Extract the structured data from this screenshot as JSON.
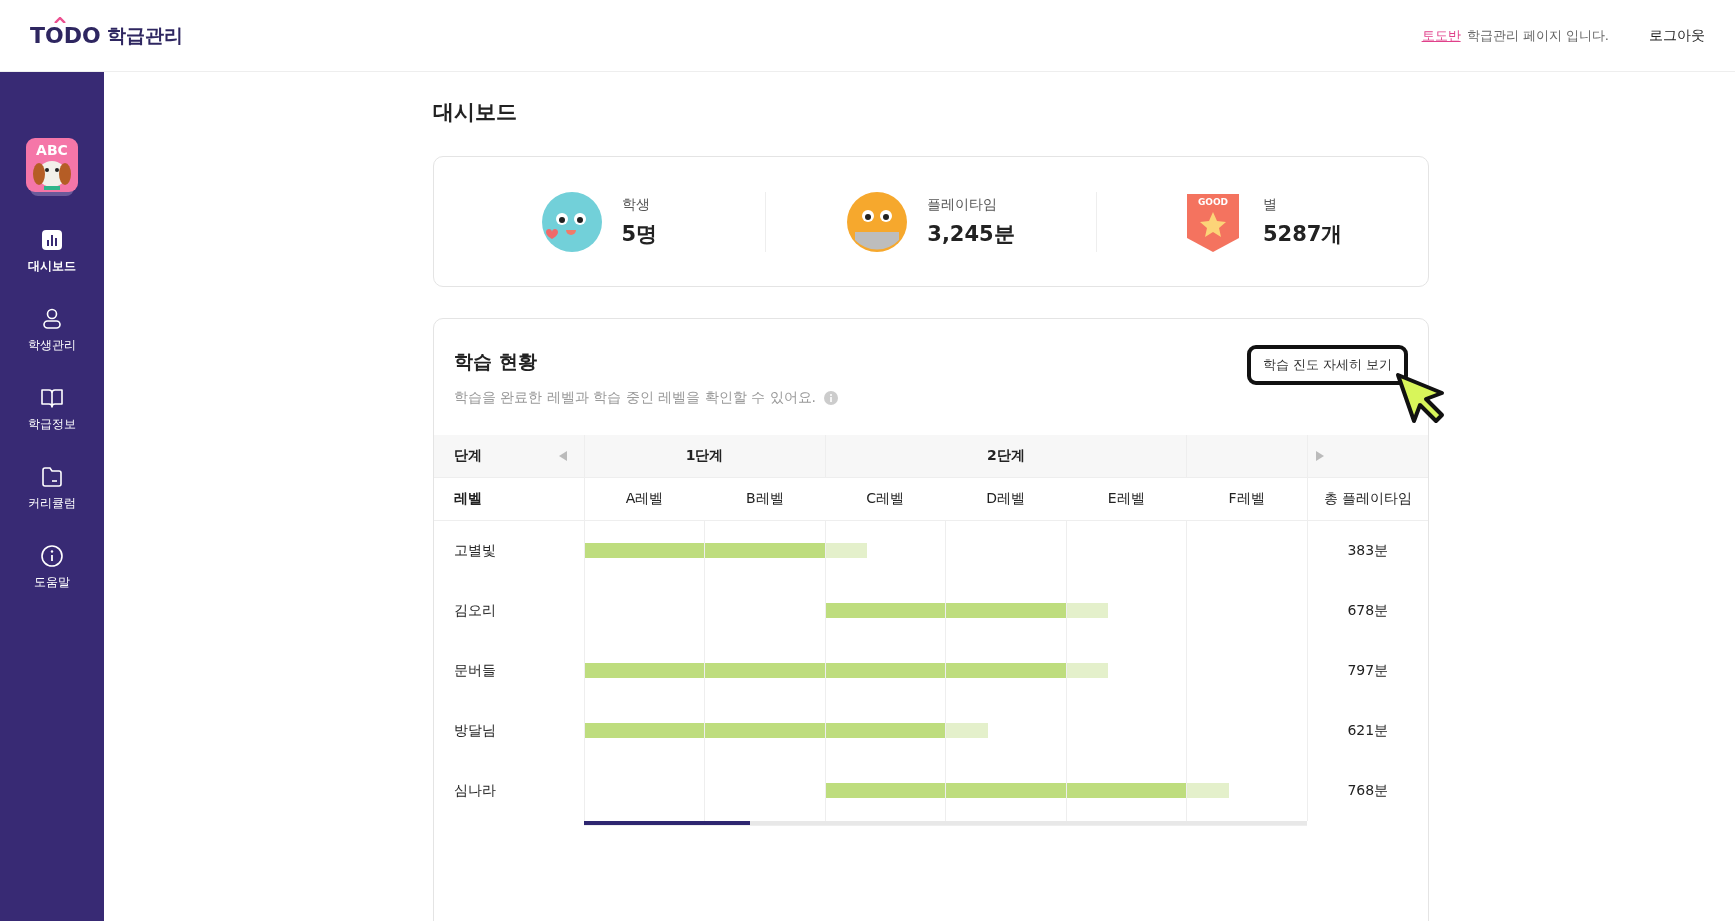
{
  "header": {
    "logo_text": "TODO",
    "logo_subtitle": "학급관리",
    "class_name": "토도반",
    "notice": "학급관리 페이지 입니다.",
    "logout": "로그아웃"
  },
  "sidebar": {
    "avatar_text": "ABC",
    "items": [
      {
        "label": "대시보드",
        "selected": true
      },
      {
        "label": "학생관리",
        "selected": false
      },
      {
        "label": "학급정보",
        "selected": false
      },
      {
        "label": "커리큘럼",
        "selected": false
      },
      {
        "label": "도움말",
        "selected": false
      }
    ]
  },
  "page_title": "대시보드",
  "stats": [
    {
      "kind": "blue-face",
      "label": "학생",
      "value": "5명"
    },
    {
      "kind": "orange-face",
      "label": "플레이타임",
      "value": "3,245분"
    },
    {
      "kind": "badge",
      "badge_text": "GOOD",
      "label": "별",
      "value": "5287개"
    }
  ],
  "progress": {
    "title": "학습 현황",
    "description": "학습을 완료한 레벨과 학습 중인 레벨을 확인할 수 있어요.",
    "detail_button": "학습 진도 자세히 보기",
    "stage_header": "단계",
    "level_header": "레벨",
    "total_header": "총 플레이타임",
    "stages": [
      {
        "label": "1단계",
        "levels": [
          "A레벨",
          "B레벨"
        ]
      },
      {
        "label": "2단계",
        "levels": [
          "C레벨",
          "D레벨",
          "E레벨"
        ]
      },
      {
        "levels": [
          "F레벨"
        ]
      }
    ],
    "rows": [
      {
        "name": "고별빛",
        "total": "383분",
        "cells": [
          {
            "completed": true
          },
          {
            "completed": true
          },
          {
            "completed": false,
            "level": 0.35
          },
          {
            "completed": false
          },
          {
            "completed": false
          },
          {
            "completed": false
          }
        ]
      },
      {
        "name": "김오리",
        "total": "678분",
        "cells": [
          {
            "completed": false
          },
          {
            "completed": false
          },
          {
            "completed": true
          },
          {
            "completed": true
          },
          {
            "completed": false,
            "level": 0.35
          },
          {
            "completed": false
          }
        ]
      },
      {
        "name": "문버들",
        "total": "797분",
        "cells": [
          {
            "completed": true
          },
          {
            "completed": true
          },
          {
            "completed": true
          },
          {
            "completed": true
          },
          {
            "completed": false,
            "level": 0.35
          },
          {
            "completed": false
          }
        ]
      },
      {
        "name": "방달님",
        "total": "621분",
        "cells": [
          {
            "completed": true
          },
          {
            "completed": true
          },
          {
            "completed": true
          },
          {
            "completed": false,
            "level": 0.35
          },
          {
            "completed": false
          },
          {
            "completed": false
          }
        ]
      },
      {
        "name": "심나라",
        "total": "768분",
        "cells": [
          {
            "completed": false
          },
          {
            "completed": false
          },
          {
            "completed": true
          },
          {
            "completed": true
          },
          {
            "completed": true
          },
          {
            "completed": false,
            "level": 0.35
          }
        ]
      }
    ]
  }
}
